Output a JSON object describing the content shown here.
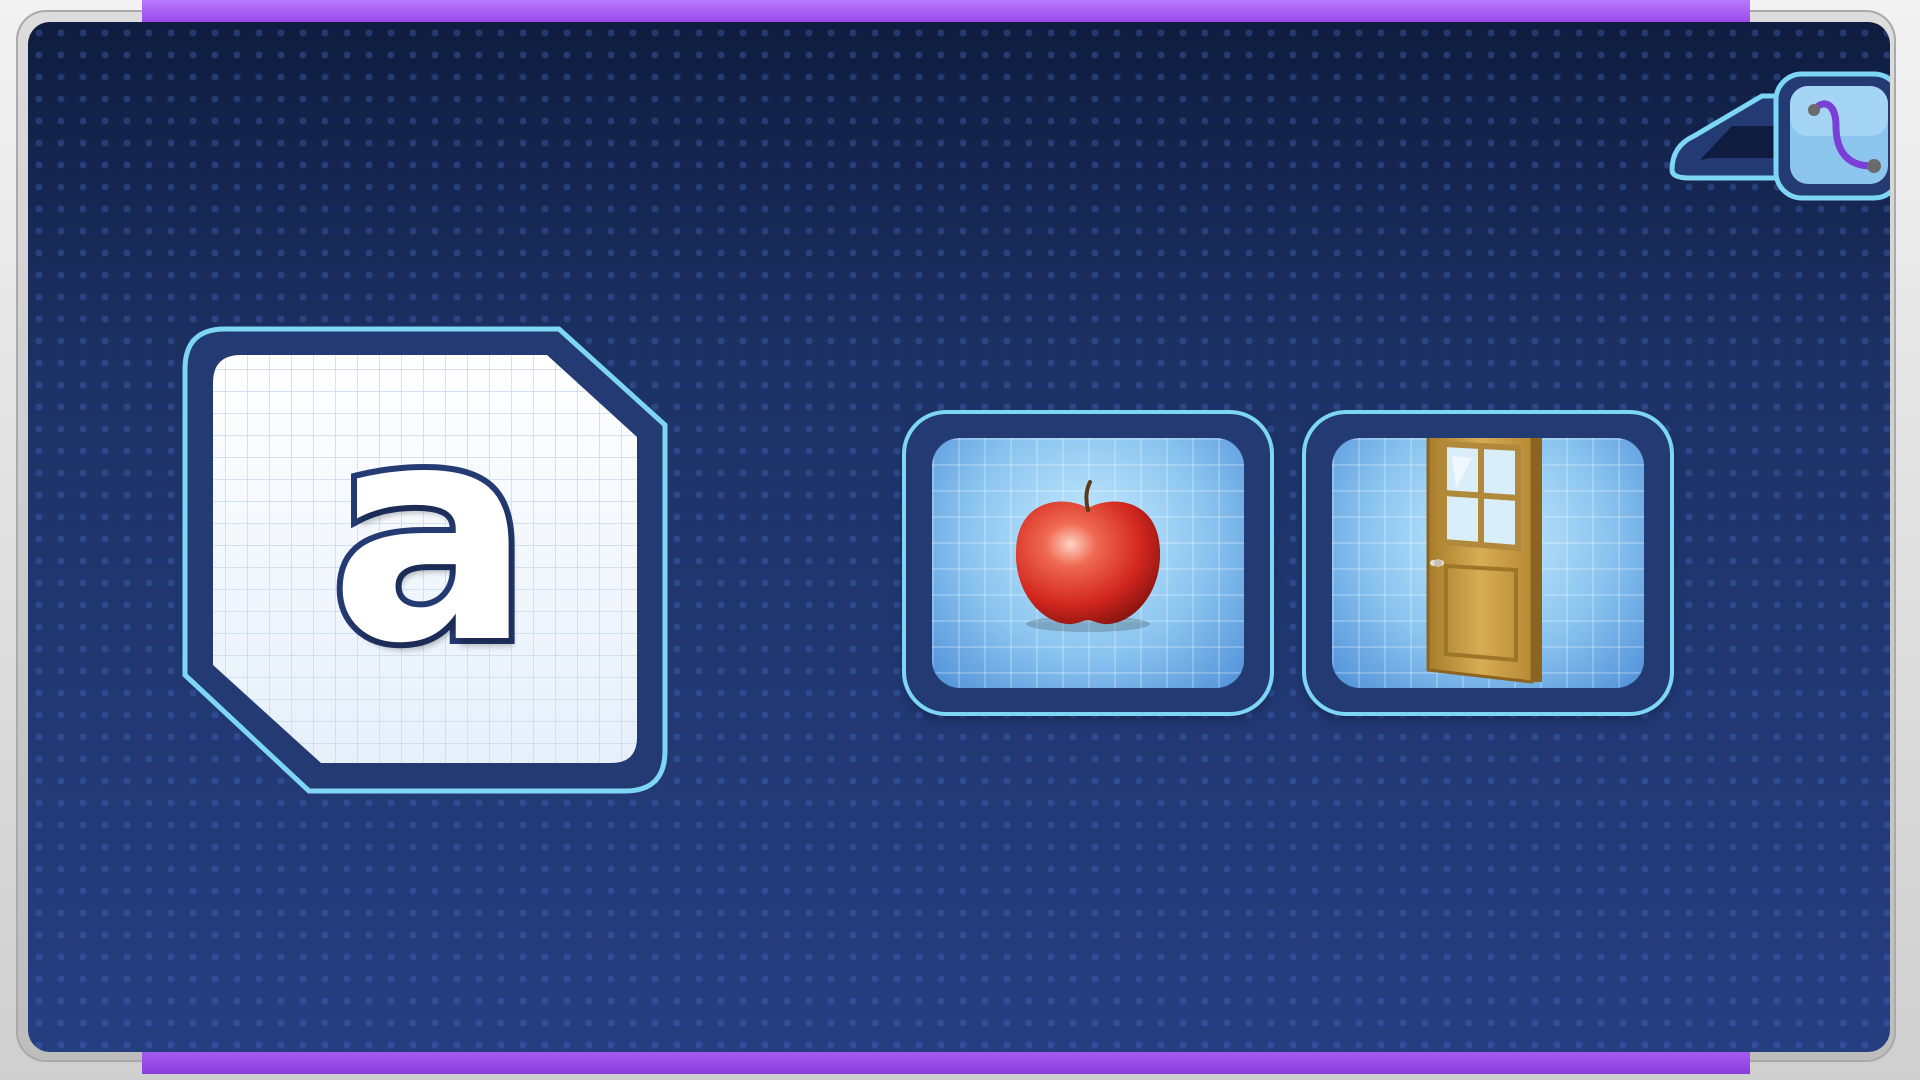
{
  "game": {
    "letter_card": {
      "letter": "a"
    },
    "choices": [
      {
        "icon": "apple-icon"
      },
      {
        "icon": "door-icon"
      }
    ],
    "tool_button": {
      "icon": "line-tracing-tool-icon"
    }
  },
  "colors": {
    "board_dark": "#0f1c3f",
    "board_light": "#253e80",
    "card_border": "#243a72",
    "card_glow": "#7dd6f4",
    "frame_purple": "#9b4be8",
    "apple_red": "#d9342b",
    "door_wood": "#c49a3c"
  }
}
